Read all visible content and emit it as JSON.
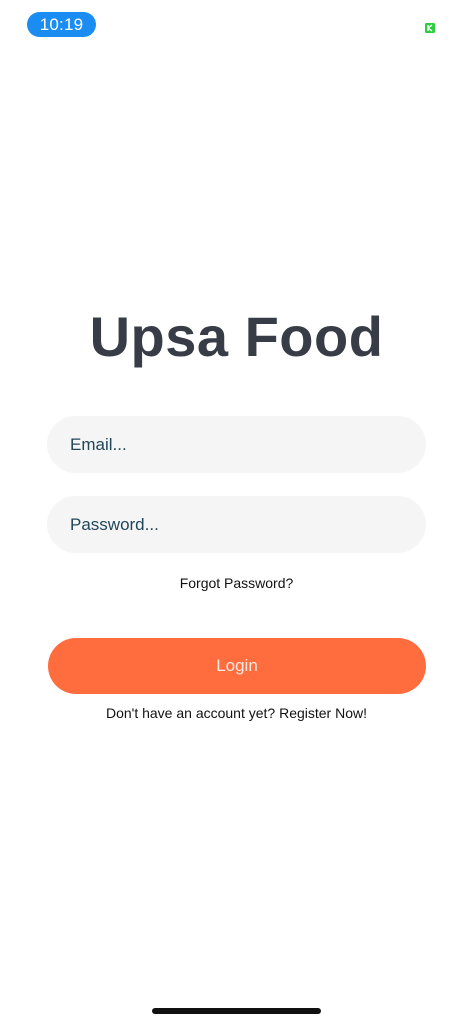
{
  "status_bar": {
    "time": "10:19",
    "indicator_icon": "battery-charging-icon",
    "indicator_color": "#2ecc40"
  },
  "app": {
    "title": "Upsa Food"
  },
  "form": {
    "email_placeholder": "Email...",
    "email_value": "",
    "password_placeholder": "Password...",
    "password_value": "",
    "forgot_label": "Forgot Password?",
    "login_label": "Login",
    "register_label": "Don't have an account yet? Register Now!"
  },
  "colors": {
    "accent": "#ff6d3f",
    "title": "#383c47",
    "input_background": "#f5f5f5",
    "status_pill": "#1b8cf2"
  }
}
